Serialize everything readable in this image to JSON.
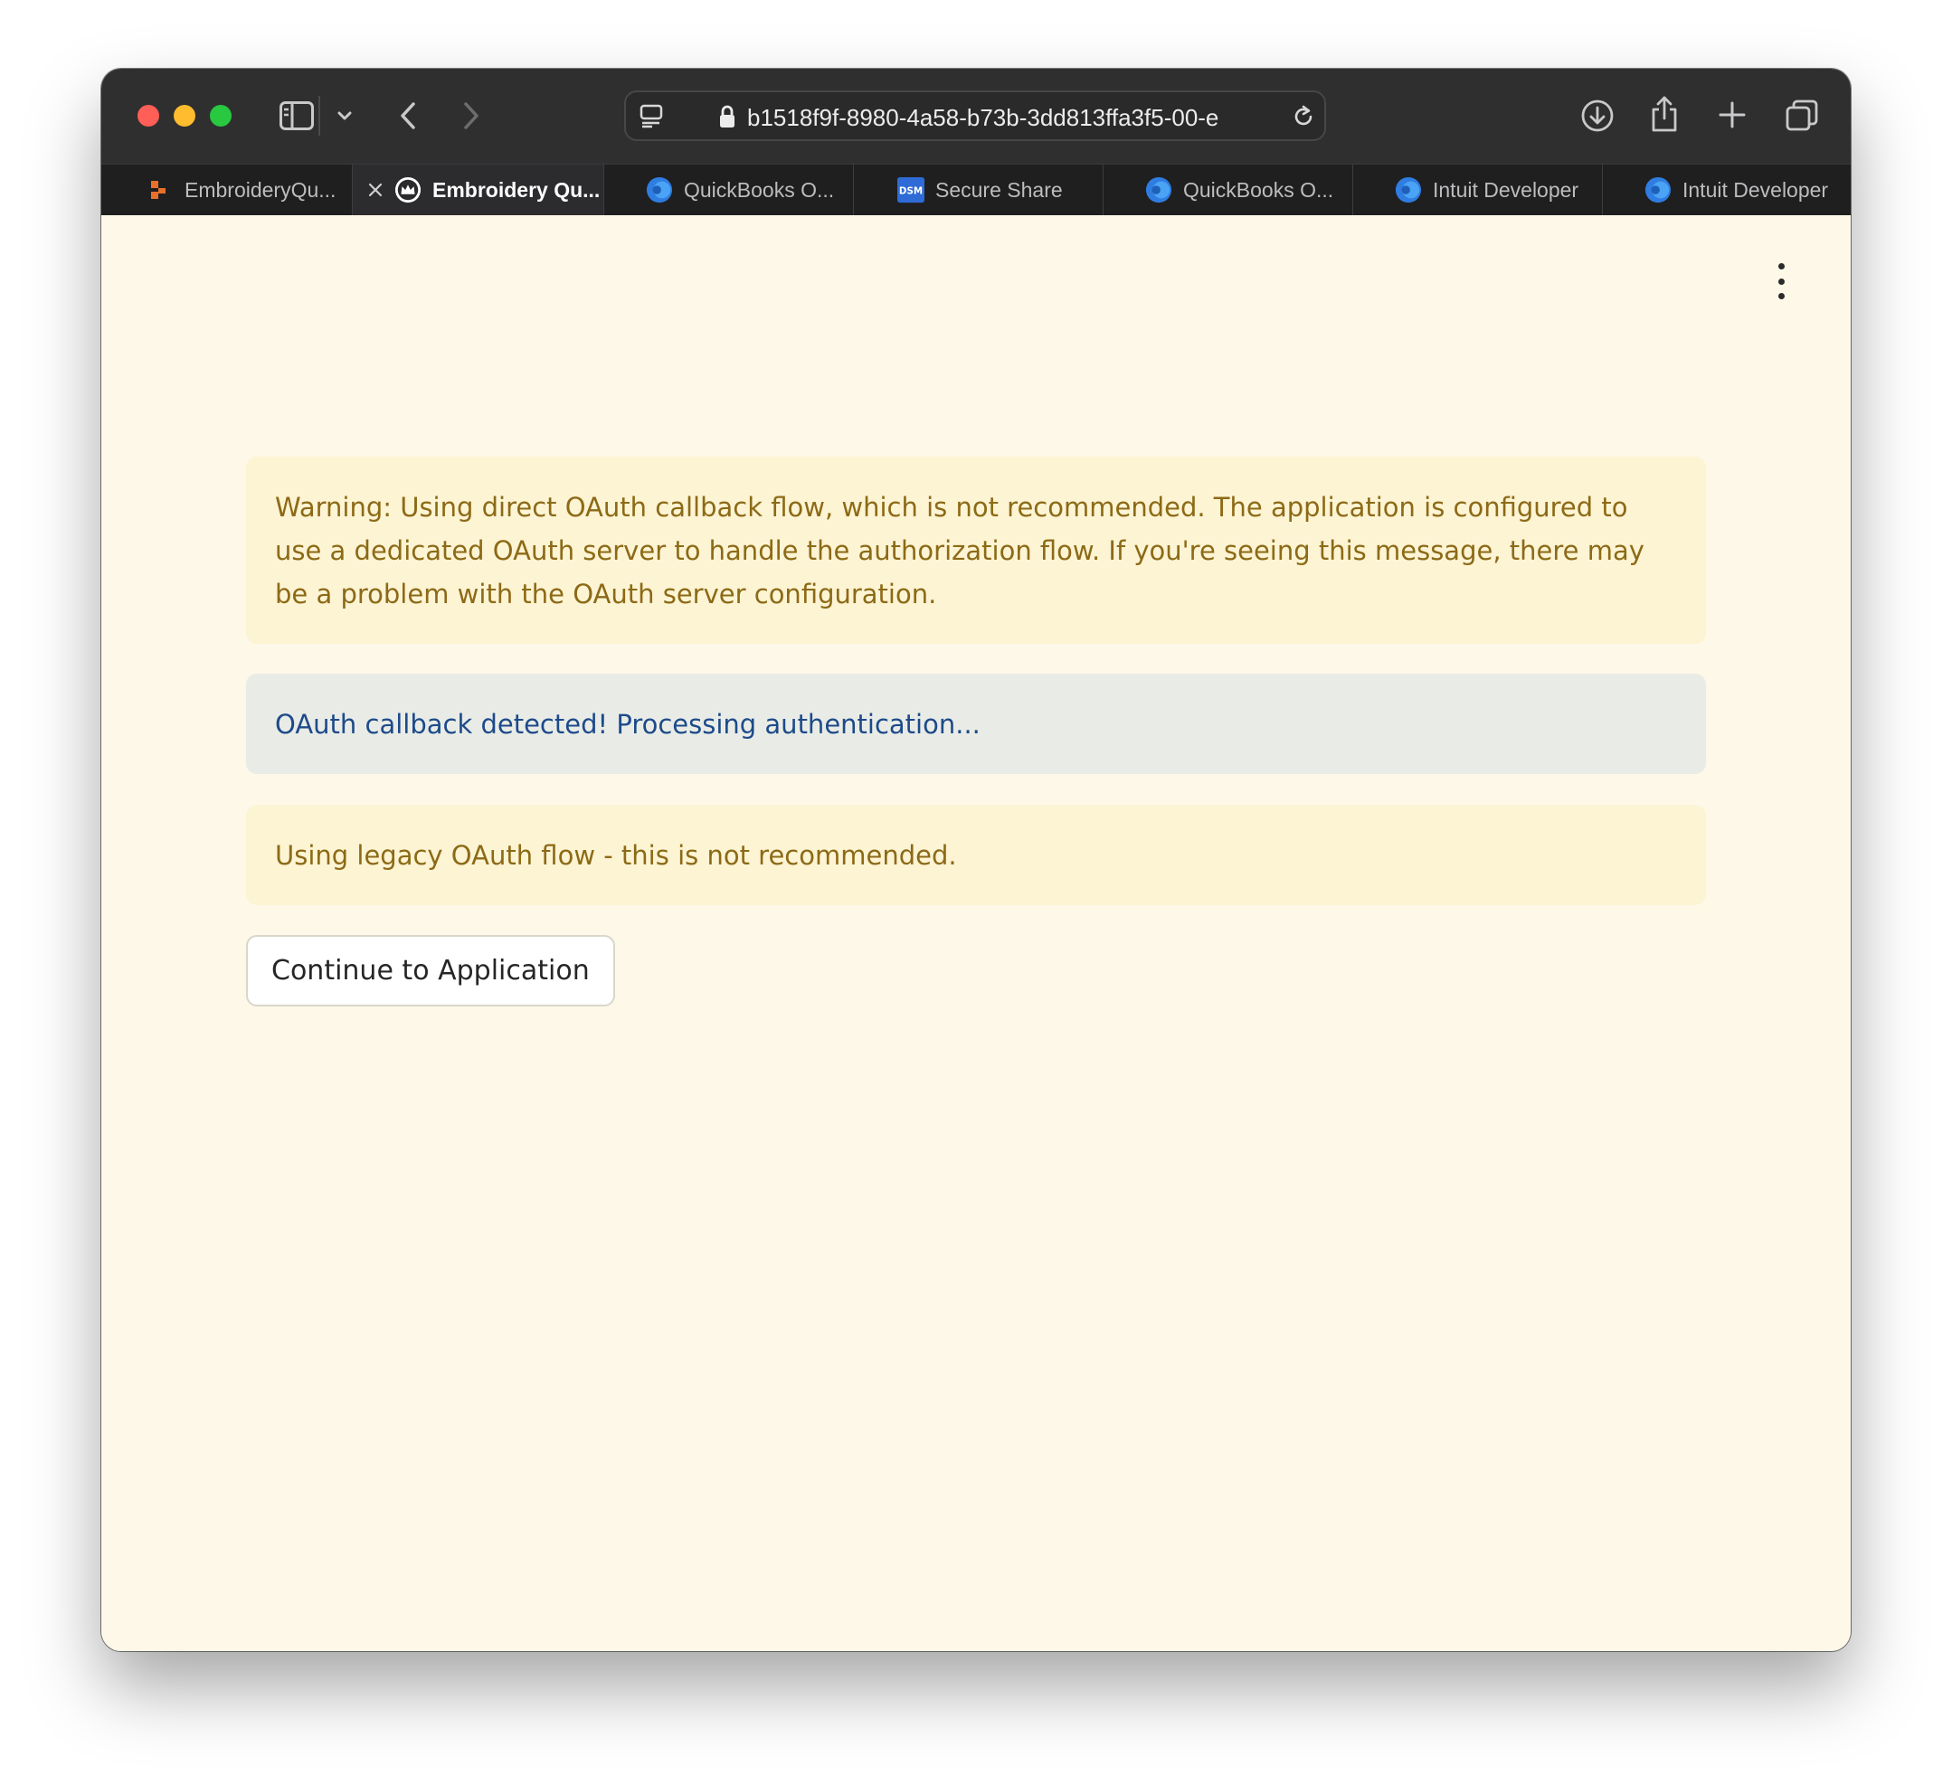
{
  "browser": {
    "url": "b1518f9f-8980-4a58-b73b-3dd813ffa3f5-00-e",
    "tabs": [
      {
        "label": "EmbroideryQu...",
        "favicon": "orange-blocks-icon",
        "active": false
      },
      {
        "label": "Embroidery Qu...",
        "favicon": "crown-icon",
        "active": true
      },
      {
        "label": "QuickBooks O...",
        "favicon": "blue-globe-icon",
        "active": false
      },
      {
        "label": "Secure Share",
        "favicon": "dsm-icon",
        "active": false
      },
      {
        "label": "QuickBooks O...",
        "favicon": "blue-globe-icon",
        "active": false
      },
      {
        "label": "Intuit Developer",
        "favicon": "blue-globe-icon",
        "active": false
      },
      {
        "label": "Intuit Developer",
        "favicon": "blue-globe-icon",
        "active": false
      }
    ],
    "dsm_badge": "DSM"
  },
  "page": {
    "warning_main": "Warning: Using direct OAuth callback flow, which is not recommended. The application is configured to use a dedicated OAuth server to handle the authorization flow. If you're seeing this message, there may be a problem with the OAuth server configuration.",
    "info_callback": "OAuth callback detected! Processing authentication...",
    "warning_legacy": "Using legacy OAuth flow - this is not recommended.",
    "continue_button": "Continue to Application"
  },
  "colors": {
    "page_background": "#fdf8e8",
    "warning_background": "#fdf4d4",
    "warning_text": "#8c6a16",
    "info_background": "#e9ece6",
    "info_text": "#1d4a8a"
  }
}
